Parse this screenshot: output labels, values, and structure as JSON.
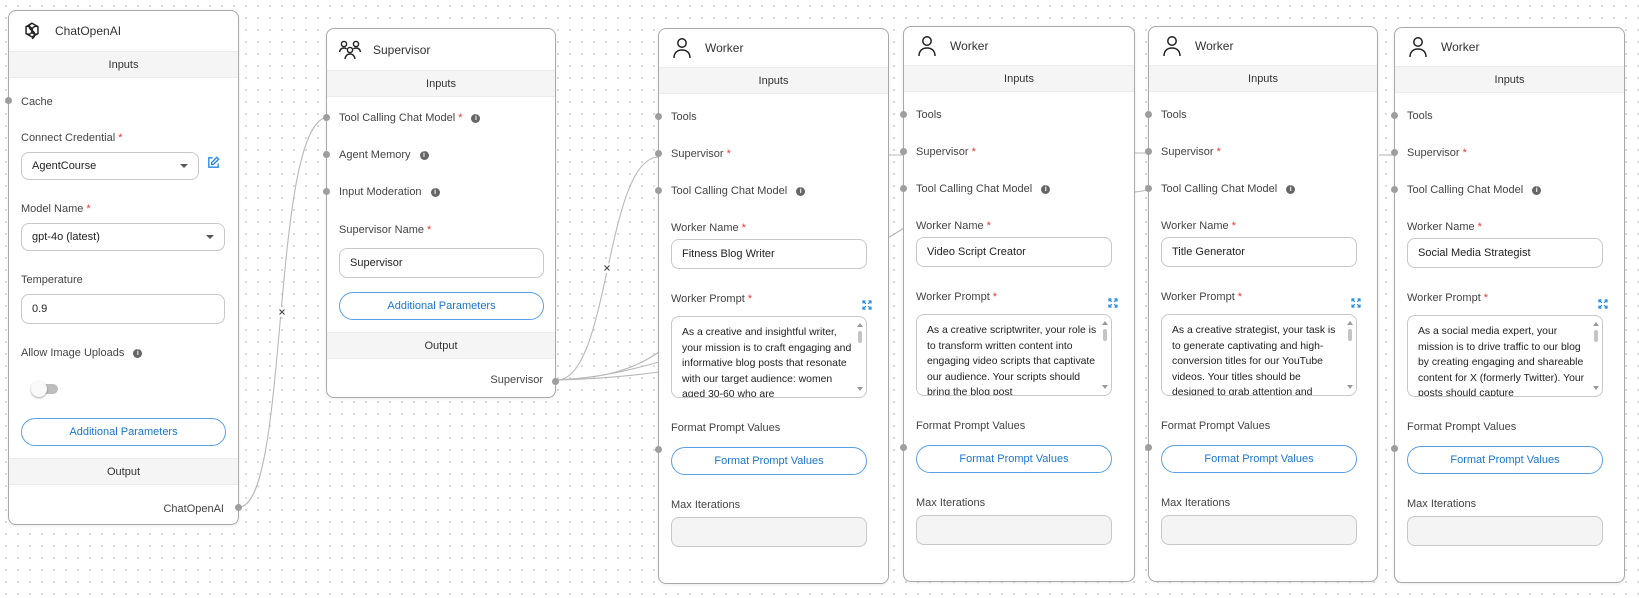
{
  "nodes": {
    "chat": {
      "title": "ChatOpenAI",
      "inputs_label": "Inputs",
      "cache_label": "Cache",
      "credential_label": "Connect Credential",
      "credential_value": "AgentCourse",
      "model_label": "Model Name",
      "model_value": "gpt-4o (latest)",
      "temperature_label": "Temperature",
      "temperature_value": "0.9",
      "image_uploads_label": "Allow Image Uploads",
      "additional_params": "Additional Parameters",
      "output_label": "Output",
      "output_name": "ChatOpenAI"
    },
    "supervisor": {
      "title": "Supervisor",
      "inputs_label": "Inputs",
      "tool_model_label": "Tool Calling Chat Model",
      "agent_memory_label": "Agent Memory",
      "input_moderation_label": "Input Moderation",
      "name_label": "Supervisor Name",
      "name_value": "Supervisor",
      "additional_params": "Additional Parameters",
      "output_label": "Output",
      "output_name": "Supervisor"
    },
    "workers": [
      {
        "title": "Worker",
        "inputs_label": "Inputs",
        "tools_label": "Tools",
        "supervisor_label": "Supervisor",
        "tool_model_label": "Tool Calling Chat Model",
        "name_label": "Worker Name",
        "name_value": "Fitness Blog Writer",
        "prompt_label": "Worker Prompt",
        "prompt_text": "As a creative and insightful writer, your mission is to craft engaging and informative blog posts that resonate with our target audience: women aged 30-60 who are",
        "format_label": "Format Prompt Values",
        "format_button": "Format Prompt Values",
        "max_iter_label": "Max Iterations",
        "max_iter_value": ""
      },
      {
        "title": "Worker",
        "inputs_label": "Inputs",
        "tools_label": "Tools",
        "supervisor_label": "Supervisor",
        "tool_model_label": "Tool Calling Chat Model",
        "name_label": "Worker Name",
        "name_value": "Video Script Creator",
        "prompt_label": "Worker Prompt",
        "prompt_text": "As a creative scriptwriter, your role is to transform written content into engaging video scripts that captivate our audience. Your scripts should bring the blog post",
        "format_label": "Format Prompt Values",
        "format_button": "Format Prompt Values",
        "max_iter_label": "Max Iterations",
        "max_iter_value": ""
      },
      {
        "title": "Worker",
        "inputs_label": "Inputs",
        "tools_label": "Tools",
        "supervisor_label": "Supervisor",
        "tool_model_label": "Tool Calling Chat Model",
        "name_label": "Worker Name",
        "name_value": "Title Generator",
        "prompt_label": "Worker Prompt",
        "prompt_text": "As a creative strategist, your task is to generate captivating and high-conversion titles for our YouTube videos. Your titles should be designed to grab attention and",
        "format_label": "Format Prompt Values",
        "format_button": "Format Prompt Values",
        "max_iter_label": "Max Iterations",
        "max_iter_value": ""
      },
      {
        "title": "Worker",
        "inputs_label": "Inputs",
        "tools_label": "Tools",
        "supervisor_label": "Supervisor",
        "tool_model_label": "Tool Calling Chat Model",
        "name_label": "Worker Name",
        "name_value": "Social Media Strategist",
        "prompt_label": "Worker Prompt",
        "prompt_text": "As a social media expert, your mission is to drive traffic to our blog by creating engaging and shareable content for X (formerly Twitter). Your posts should capture",
        "format_label": "Format Prompt Values",
        "format_button": "Format Prompt Values",
        "max_iter_label": "Max Iterations",
        "max_iter_value": ""
      }
    ]
  },
  "colors": {
    "accent": "#1976d2",
    "required": "#e53935",
    "node_border": "#a9a9a9",
    "section_bg": "#f5f5f5"
  },
  "icons": {
    "chat": "openai-logo-icon",
    "supervisor": "team-icon",
    "worker": "person-icon",
    "edge_delete": "close-icon",
    "edit_credential": "edit-icon",
    "expand_prompt": "expand-icon",
    "info": "info-icon"
  }
}
